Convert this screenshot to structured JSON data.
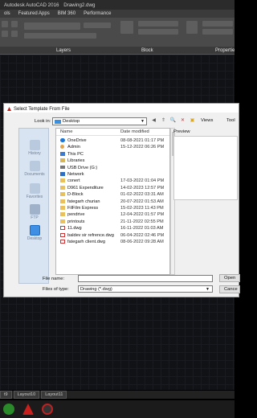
{
  "window": {
    "title": "Autodesk AutoCAD 2016",
    "document": "Drawing2.dwg"
  },
  "menu_tabs": [
    "ols",
    "Featured Apps",
    "BIM 360",
    "Performance"
  ],
  "ribbon_labels": {
    "layers": "Layers",
    "block": "Block",
    "properties": "Propertie"
  },
  "dialog": {
    "title": "Select Template From File",
    "look_in_label": "Look in:",
    "look_in_value": "Desktop",
    "views_label": "Views",
    "tools_label": "Tool",
    "places": [
      "History",
      "Documents",
      "Favorites",
      "FTP",
      "Desktop"
    ],
    "columns": {
      "name": "Name",
      "date": "Date modified"
    },
    "files": [
      {
        "icon": "onedrive-icon",
        "name": "OneDrive",
        "date": "08-08-2021 01:17 PM"
      },
      {
        "icon": "user-icon",
        "name": "Admin",
        "date": "15-12-2022 06:26 PM"
      },
      {
        "icon": "pc-icon",
        "name": "This PC",
        "date": ""
      },
      {
        "icon": "library-icon",
        "name": "Libraries",
        "date": ""
      },
      {
        "icon": "usb-icon",
        "name": "USB Drive (G:)",
        "date": ""
      },
      {
        "icon": "network-icon",
        "name": "Network",
        "date": ""
      },
      {
        "icon": "folder-icon",
        "name": "conert",
        "date": "17-03-2022 01:04 PM"
      },
      {
        "icon": "folder-icon",
        "name": "D961 Expenditure",
        "date": "14-02-2023 12:57 PM"
      },
      {
        "icon": "folder-icon",
        "name": "D-Block",
        "date": "01-02-2022 03:31 AM"
      },
      {
        "icon": "folder-icon",
        "name": "fategarh churian",
        "date": "20-07-2022 01:53 AM"
      },
      {
        "icon": "folder-icon",
        "name": "FilFilm Express",
        "date": "15-02-2023 11:43 PM"
      },
      {
        "icon": "folder-icon",
        "name": "pendrive",
        "date": "12-04-2022 01:57 PM"
      },
      {
        "icon": "folder-icon",
        "name": "printouts",
        "date": "21-11-2022 02:55 PM"
      },
      {
        "icon": "dwg-icon",
        "name": "11.dwg",
        "date": "16-11-2022 01:03 AM"
      },
      {
        "icon": "dwg-icon",
        "name": "baldev sir refrence.dwg",
        "date": "06-04-2022 02:46 PM"
      },
      {
        "icon": "dwg-icon",
        "name": "fategarh client.dwg",
        "date": "08-06-2022 09:28 AM"
      }
    ],
    "preview_label": "Preview",
    "file_name_label": "File name:",
    "file_name_value": "",
    "file_type_label": "Files of type:",
    "file_type_value": "Drawing (*.dwg)",
    "open_label": "Open",
    "cancel_label": "Cance"
  },
  "layout_tabs": [
    "t9",
    "Layout10",
    "Layout11"
  ]
}
